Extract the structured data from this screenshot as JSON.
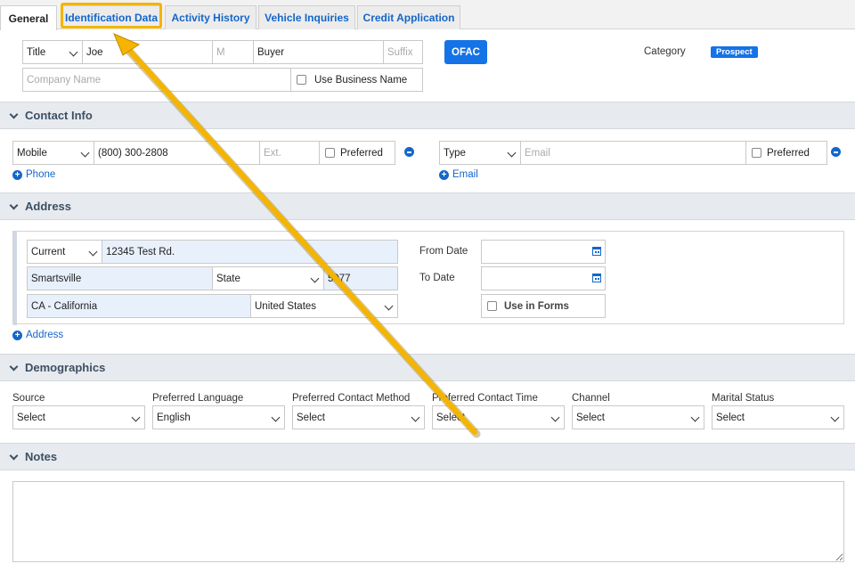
{
  "tabs": [
    "General",
    "Identification Data",
    "Activity History",
    "Vehicle Inquiries",
    "Credit Application"
  ],
  "name": {
    "title": "Title",
    "first": "Joe",
    "middle": "M",
    "last": "Buyer",
    "suffix": "Suffix",
    "company": "Company Name",
    "use_business": "Use Business Name"
  },
  "ofac": "OFAC",
  "category": {
    "label": "Category",
    "value": "Prospect"
  },
  "contact": {
    "title": "Contact Info",
    "phone_type": "Mobile",
    "phone": "(800) 300-2808",
    "ext": "Ext.",
    "preferred": "Preferred",
    "add_phone": "Phone",
    "email_type": "Type",
    "email": "Email",
    "email_preferred": "Preferred",
    "add_email": "Email"
  },
  "address": {
    "title": "Address",
    "type": "Current",
    "street": "12345 Test Rd.",
    "city": "Smartsville",
    "state": "State",
    "zip": "5977",
    "county": "CA - California",
    "country": "United States",
    "from_date": "From Date",
    "to_date": "To Date",
    "use_in_forms": "Use in Forms",
    "add_address": "Address"
  },
  "demographics": {
    "title": "Demographics",
    "fields": [
      {
        "label": "Source",
        "value": "Select"
      },
      {
        "label": "Preferred Language",
        "value": "English"
      },
      {
        "label": "Preferred Contact Method",
        "value": "Select"
      },
      {
        "label": "Preferred Contact Time",
        "value": "Select"
      },
      {
        "label": "Channel",
        "value": "Select"
      },
      {
        "label": "Marital Status",
        "value": "Select"
      }
    ]
  },
  "notes": {
    "title": "Notes"
  },
  "colors": {
    "accent": "#1473e6",
    "link": "#1466c9",
    "highlight": "#f4b400"
  }
}
